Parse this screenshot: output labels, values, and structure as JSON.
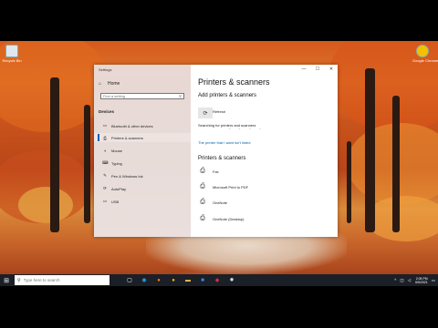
{
  "desktop": {
    "icons": [
      {
        "name": "Recycle Bin"
      },
      {
        "name": "Google Chrome"
      }
    ]
  },
  "window": {
    "title": "Settings",
    "controls": {
      "minimize": "—",
      "maximize": "☐",
      "close": "✕"
    },
    "sidebar": {
      "home": "Home",
      "search_placeholder": "Find a setting",
      "section": "Devices",
      "items": [
        {
          "label": "Bluetooth & other devices",
          "icon": "bluetooth-icon",
          "glyph": "▭"
        },
        {
          "label": "Printers & scanners",
          "icon": "printer-icon",
          "glyph": "⎙",
          "active": true
        },
        {
          "label": "Mouse",
          "icon": "mouse-icon",
          "glyph": "◖"
        },
        {
          "label": "Typing",
          "icon": "keyboard-icon",
          "glyph": "⌨"
        },
        {
          "label": "Pen & Windows Ink",
          "icon": "pen-icon",
          "glyph": "✎"
        },
        {
          "label": "AutoPlay",
          "icon": "autoplay-icon",
          "glyph": "⟳"
        },
        {
          "label": "USB",
          "icon": "usb-icon",
          "glyph": "▭"
        }
      ]
    },
    "main": {
      "title": "Printers & scanners",
      "add_heading": "Add printers & scanners",
      "refresh_label": "Refresh",
      "searching_text": "Searching for printers and scanners",
      "link_text": "The printer that I want isn't listed",
      "list_heading": "Printers & scanners",
      "printers": [
        {
          "name": "Fax"
        },
        {
          "name": "Microsoft Print to PDF"
        },
        {
          "name": "OneNote"
        },
        {
          "name": "OneNote (Desktop)"
        }
      ]
    }
  },
  "taskbar": {
    "search_placeholder": "Type here to search",
    "apps": [
      {
        "icon": "task-view-icon",
        "glyph": "▢",
        "color": "#ffffff"
      },
      {
        "icon": "edge-icon",
        "glyph": "◉",
        "color": "#2aa3e8"
      },
      {
        "icon": "firefox-icon",
        "glyph": "●",
        "color": "#ff7a1a"
      },
      {
        "icon": "chrome-icon",
        "glyph": "●",
        "color": "#f2c200"
      },
      {
        "icon": "explorer-icon",
        "glyph": "▬",
        "color": "#f4c542"
      },
      {
        "icon": "store-icon",
        "glyph": "■",
        "color": "#3a8ee6"
      },
      {
        "icon": "app-icon",
        "glyph": "◆",
        "color": "#cc3344"
      },
      {
        "icon": "settings-icon",
        "glyph": "✹",
        "color": "#dddddd"
      }
    ],
    "clock_time": "2:05 PM",
    "clock_date": "6/5/2021"
  }
}
